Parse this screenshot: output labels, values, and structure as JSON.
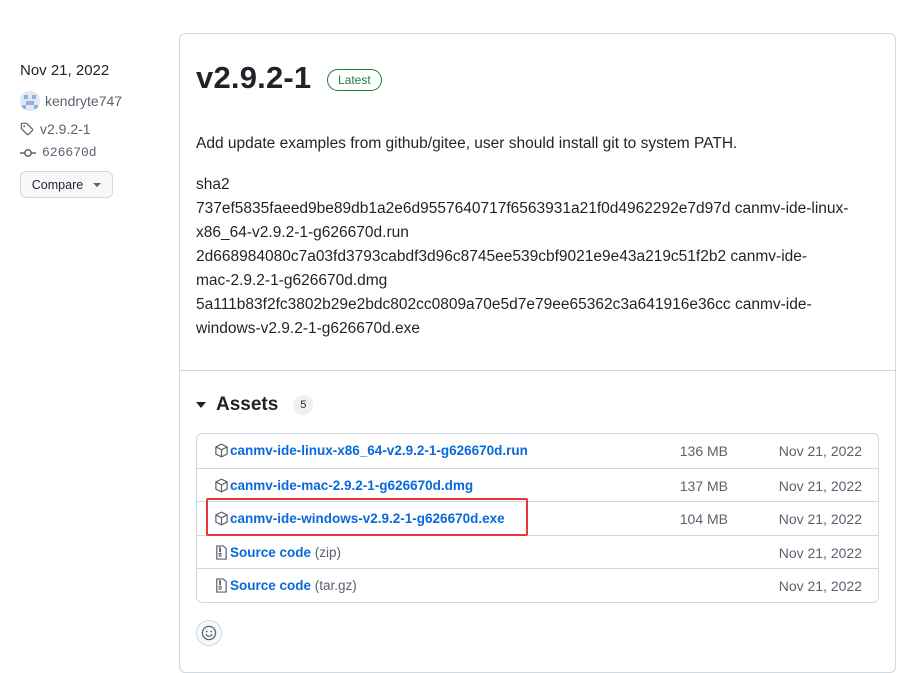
{
  "sidebar": {
    "date": "Nov 21, 2022",
    "author": "kendryte747",
    "tag": "v2.9.2-1",
    "commit": "626670d",
    "compare_label": "Compare"
  },
  "release": {
    "title": "v2.9.2-1",
    "badge": "Latest",
    "description": "Add update examples from github/gitee, user should install git to system PATH.",
    "sha_lines": [
      "sha2",
      "737ef5835faeed9be89db1a2e6d9557640717f6563931a21f0d4962292e7d97d canmv-ide-linux-",
      "x86_64-v2.9.2-1-g626670d.run",
      "2d668984080c7a03fd3793cabdf3d96c8745ee539cbf9021e9e43a219c51f2b2 canmv-ide-",
      "mac-2.9.2-1-g626670d.dmg",
      "5a111b83f2fc3802b29e2bdc802cc0809a70e5d7e79ee65362c3a641916e36cc canmv-ide-",
      "windows-v2.9.2-1-g626670d.exe"
    ]
  },
  "assets": {
    "title": "Assets",
    "count": "5",
    "items": [
      {
        "name": "canmv-ide-linux-x86_64-v2.9.2-1-g626670d.run",
        "suffix": "",
        "size": "136 MB",
        "date": "Nov 21, 2022",
        "icon": "package-icon"
      },
      {
        "name": "canmv-ide-mac-2.9.2-1-g626670d.dmg",
        "suffix": "",
        "size": "137 MB",
        "date": "Nov 21, 2022",
        "icon": "package-icon"
      },
      {
        "name": "canmv-ide-windows-v2.9.2-1-g626670d.exe",
        "suffix": "",
        "size": "104 MB",
        "date": "Nov 21, 2022",
        "icon": "package-icon"
      },
      {
        "name": "Source code",
        "suffix": " (zip)",
        "size": "",
        "date": "Nov 21, 2022",
        "icon": "file-zip-icon"
      },
      {
        "name": "Source code",
        "suffix": " (tar.gz)",
        "size": "",
        "date": "Nov 21, 2022",
        "icon": "file-zip-icon"
      }
    ]
  },
  "colors": {
    "link": "#0969da",
    "latest_badge": "#1a7f37",
    "highlight": "#e53935"
  }
}
